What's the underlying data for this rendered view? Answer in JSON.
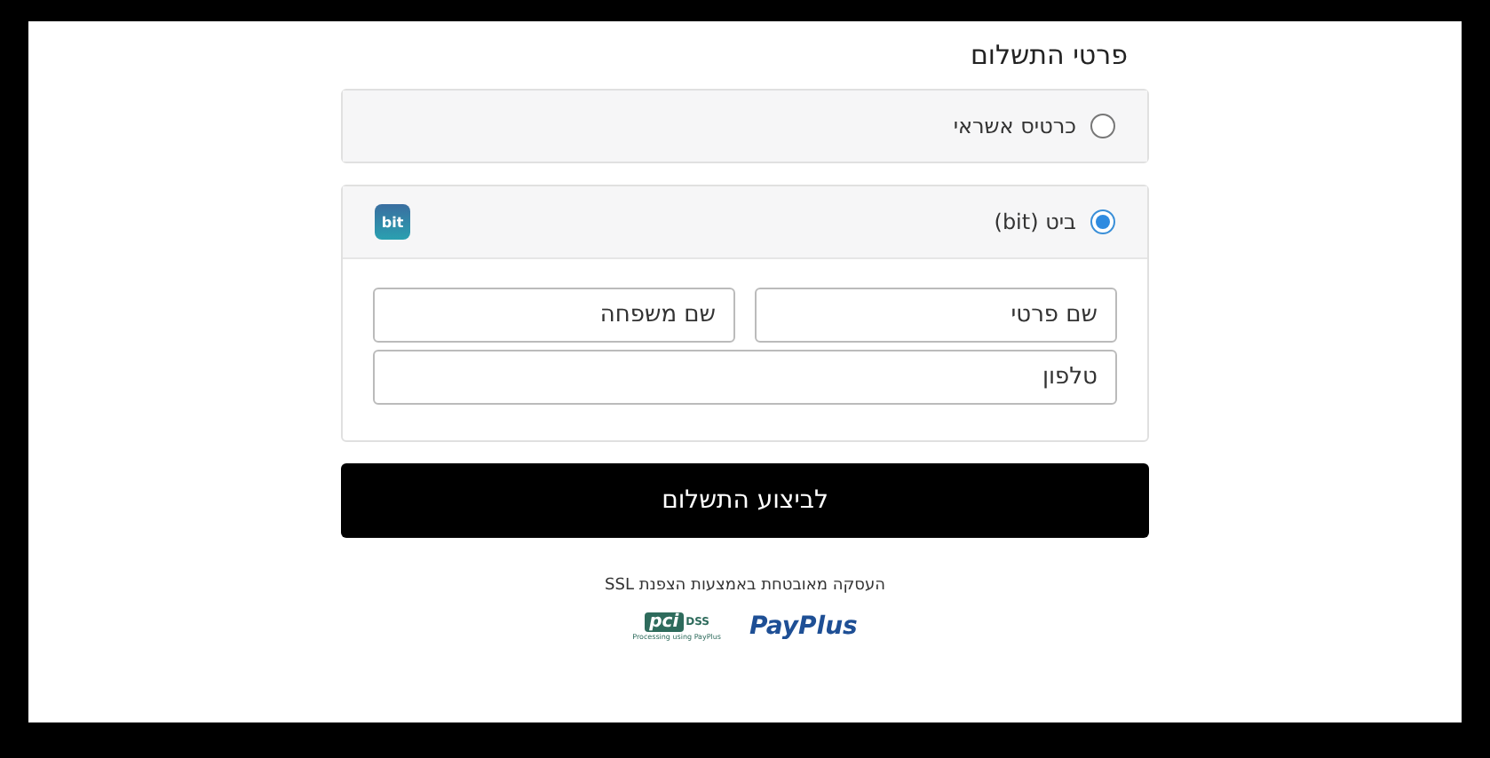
{
  "title": "פרטי התשלום",
  "methods": [
    {
      "label": "כרטיס אשראי",
      "selected": false
    },
    {
      "label": "ביט (bit)",
      "selected": true,
      "icon_text": "bit",
      "fields": [
        {
          "placeholder": "שם פרטי"
        },
        {
          "placeholder": "שם משפחה"
        },
        {
          "placeholder": "טלפון"
        }
      ]
    }
  ],
  "submit_button": "לביצוע התשלום",
  "security_note": "העסקה מאובטחת באמצעות הצפנת SSL",
  "logos": {
    "pci": "pci",
    "dss": "DSS",
    "pci_caption": "Processing using PayPlus",
    "payplus": "PayPlus"
  }
}
